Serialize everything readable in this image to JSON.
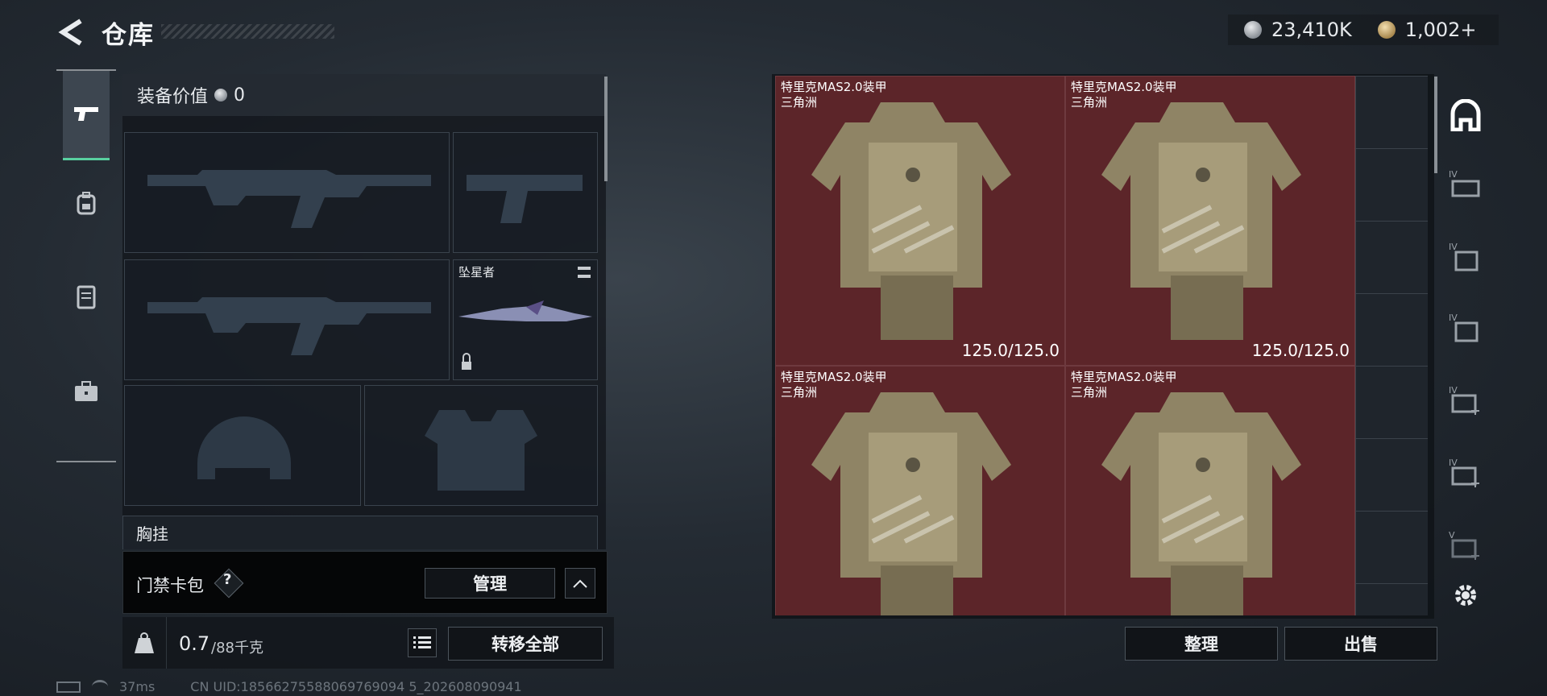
{
  "header": {
    "title": "仓库",
    "silver_amount": "23,410K",
    "gold_amount": "1,002+"
  },
  "loadout": {
    "value_label": "装备价值",
    "value_amount": "0",
    "melee_name": "坠星者",
    "chest_rig_label": "胸挂",
    "chest_rig_help": "?"
  },
  "keycard": {
    "label": "门禁卡包",
    "help": "?",
    "manage_label": "管理"
  },
  "weight": {
    "current": "0.7",
    "max_unit": "/88千克",
    "transfer_all_label": "转移全部"
  },
  "status": {
    "ping": "37ms",
    "uid": "CN UID:18566275588069769094 5_202608090941"
  },
  "stash": {
    "items": [
      {
        "name": "特里克MAS2.0装甲",
        "sub": "三角洲",
        "durability": "125.0/125.0"
      },
      {
        "name": "特里克MAS2.0装甲",
        "sub": "三角洲",
        "durability": "125.0/125.0"
      },
      {
        "name": "特里克MAS2.0装甲",
        "sub": "三角洲",
        "durability": ""
      },
      {
        "name": "特里克MAS2.0装甲",
        "sub": "三角洲",
        "durability": ""
      }
    ],
    "sort_label": "整理",
    "sell_label": "出售"
  },
  "right_rail": {
    "tabs": [
      "IV",
      "IV",
      "IV",
      "IV",
      "IV",
      "V"
    ]
  }
}
